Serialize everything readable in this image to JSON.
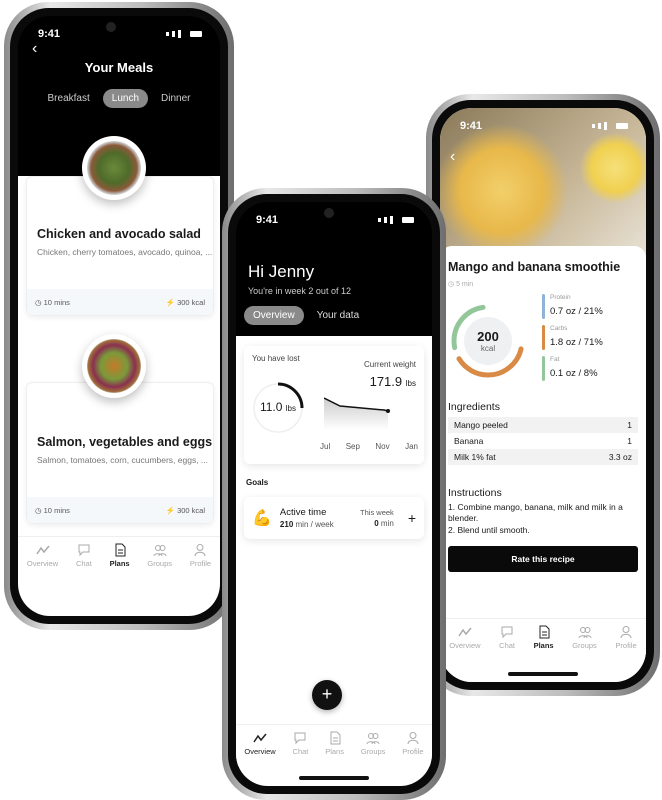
{
  "status_time": "9:41",
  "tabbar": [
    "Overview",
    "Chat",
    "Plans",
    "Groups",
    "Profile"
  ],
  "meals": {
    "title": "Your Meals",
    "tabs": [
      "Breakfast",
      "Lunch",
      "Dinner"
    ],
    "selected_tab": "Lunch",
    "items": [
      {
        "name": "Chicken and avocado salad",
        "ingredients": "Chicken, cherry tomatoes, avocado, quinoa, ...",
        "time": "10 mins",
        "kcal": "300 kcal"
      },
      {
        "name": "Salmon, vegetables and eggs",
        "ingredients": "Salmon, tomatoes, corn, cucumbers, eggs, ...",
        "time": "10 mins",
        "kcal": "300 kcal"
      }
    ],
    "active_tab": "Plans"
  },
  "overview": {
    "greeting": "Hi Jenny",
    "subtitle": "You're in week 2 out of 12",
    "tabs": [
      "Overview",
      "Your data"
    ],
    "lost_label": "You have lost",
    "lost_value": "11.0",
    "lost_unit": "lbs",
    "current_label": "Current weight",
    "current_value": "171.9",
    "current_unit": "lbs",
    "months": [
      "Jul",
      "Sep",
      "Nov",
      "Jan"
    ],
    "goals_label": "Goals",
    "goal": {
      "name": "Active time",
      "target": "210",
      "target_unit": "min / week",
      "week_label": "This week",
      "week_value": "0",
      "week_unit": "min"
    },
    "fab": "+",
    "active_tab": "Overview"
  },
  "recipe": {
    "title": "Mango and banana smoothie",
    "time": "5 min",
    "kcal": "200",
    "kcal_unit": "kcal",
    "macros": [
      {
        "name": "Protein",
        "value": "0.7 oz / 21%",
        "color": "#8fb3d6"
      },
      {
        "name": "Carbs",
        "value": "1.8 oz / 71%",
        "color": "#d98a45"
      },
      {
        "name": "Fat",
        "value": "0.1 oz / 8%",
        "color": "#93c79a"
      }
    ],
    "ingredients_label": "Ingredients",
    "ingredients": [
      {
        "name": "Mango peeled",
        "qty": "1"
      },
      {
        "name": "Banana",
        "qty": "1"
      },
      {
        "name": "Milk 1% fat",
        "qty": "3.3 oz"
      }
    ],
    "instructions_label": "Instructions",
    "instructions": [
      "1. Combine mango, banana, milk and milk in a blender.",
      "2. Blend until smooth."
    ],
    "rate_button": "Rate this recipe",
    "active_tab": "Plans"
  }
}
